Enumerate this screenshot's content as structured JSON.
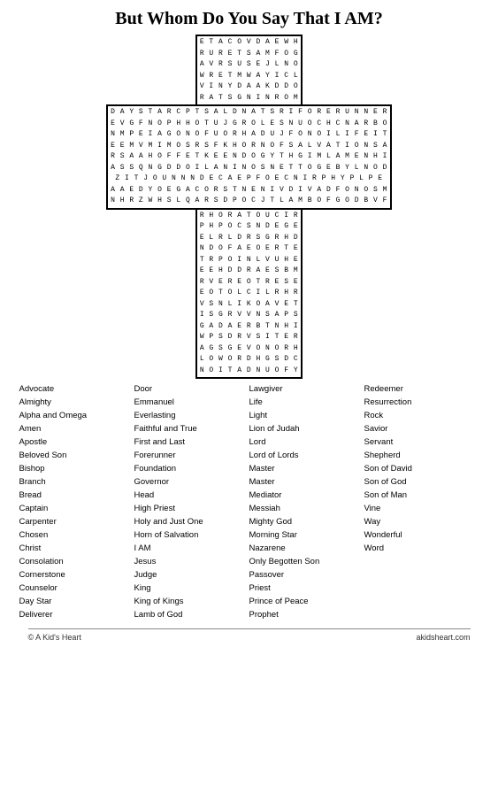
{
  "title": "But Whom Do You Say That I AM?",
  "puzzle": {
    "top_rows": [
      "E T A C O V D A E W H",
      "R U R E T S A M F O G",
      "A V R S U S E J L N O",
      "W R E T M W A Y I C L",
      "V I N Y D A A K D D O",
      "R A T S G N I N R O M"
    ],
    "middle_rows_left": [
      "D A Y S T A R C P T S A L D N A T S R I F O R E R U N N E R",
      "E V G F N O P H H O T U J G R O L E S N U O C H C N A R B O",
      "N M P E I A G O N O F U O R H A D U J F O N O I L I F E I T",
      "E E M V M I M O S R S F K H O R N O F S A L V A T I O N S A",
      "R S A A H O F F E T K E E N D O G Y T H G I M L A M E N H I",
      "A S S Q N G D D O I L A N I N O S N E T T O G E B Y L N O D",
      "Z I T J O U N N N D E C A E P F O E C N I R P H Y P L P E",
      "A A E D Y O E G A C O R S T N E N I V D I V A D F O N O S M",
      "N H R Z W H S L Q A R S D P O C J T L A M B O F G O D B V F"
    ],
    "middle_rows_center": [
      "R H O R A T O U C I R",
      "P H P O C S N D E G E",
      "E L R L D R S G R H D",
      "N D O F A E O E R T E",
      "T R P O I N L V U H E",
      "E E H D D R A E S B M",
      "R V E R E O T R E S E",
      "E O T O L C I L R H R",
      "V S N L I K O A V E T",
      "I S G R V V N S A P S",
      "G A D A E R B T N H I",
      "W P S D R V S I T E R",
      "A G S G E V O N O R H",
      "L O W O R D H G S D C",
      "N O I T A D N U O F Y"
    ],
    "words": {
      "col1": [
        "Advocate",
        "Almighty",
        "Alpha and Omega",
        "Amen",
        "Apostle",
        "Beloved Son",
        "Bishop",
        "Branch",
        "Bread",
        "Captain",
        "Carpenter",
        "Chosen",
        "Christ",
        "Consolation",
        "Cornerstone",
        "Counselor",
        "Day Star",
        "Deliverer"
      ],
      "col2": [
        "Door",
        "Emmanuel",
        "Everlasting",
        "Faithful and True",
        "First and Last",
        "Forerunner",
        "Foundation",
        "Governor",
        "Head",
        "High Priest",
        "Holy and Just One",
        "Horn of Salvation",
        "I AM",
        "Jesus",
        "Judge",
        "King",
        "King of Kings",
        "Lamb of God"
      ],
      "col3": [
        "Lawgiver",
        "Life",
        "Light",
        "Lion of Judah",
        "Lord",
        "Lord of Lords",
        "Master",
        "Master",
        "Mediator",
        "Messiah",
        "Mighty God",
        "Morning Star",
        "Nazarene",
        "Only Begotten Son",
        "Passover",
        "Priest",
        "Prince of Peace",
        "Prophet"
      ],
      "col4": [
        "Redeemer",
        "Resurrection",
        "Rock",
        "Savior",
        "Servant",
        "Shepherd",
        "Son of David",
        "Son of God",
        "Son of Man",
        "Vine",
        "Way",
        "Wonderful",
        "Word",
        "",
        "",
        "",
        "",
        ""
      ]
    }
  },
  "footer": {
    "left": "© A Kid's Heart",
    "right": "akidsheart.com"
  }
}
